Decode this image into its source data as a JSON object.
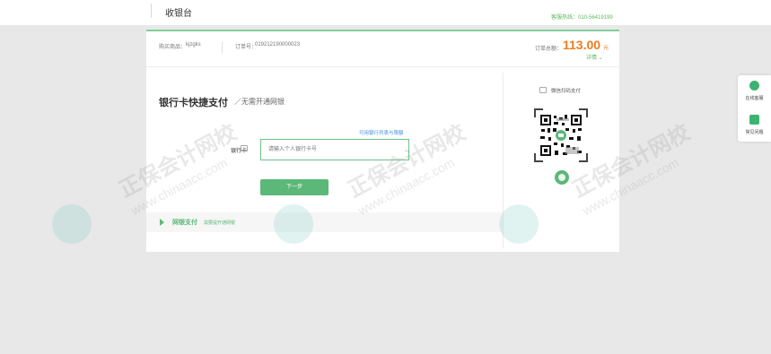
{
  "topbar": {
    "title": "收银台",
    "hotline": "客服热线：010-56419199"
  },
  "order": {
    "merchant_label": "购买商品：",
    "merchant_value": "kjzgks",
    "order_label": "订单号：",
    "order_value": "019212190000023",
    "total_label": "订单总额：",
    "total_amount": "113.00",
    "currency": "元",
    "detail_link": "详情 ⌄"
  },
  "bank_pay": {
    "title": "银行卡快捷支付",
    "subtitle": "／无需开通网银",
    "supported_link": "可用银行列表与限额",
    "card_label": "银行卡",
    "card_placeholder": "请输入个人银行卡号",
    "next_button": "下一步"
  },
  "netbank": {
    "label": "网银支付",
    "note": "需要提开通网银"
  },
  "wechat": {
    "label": "微信扫码支付"
  },
  "side": {
    "online_service": "在线客服",
    "faq": "常见问题"
  },
  "watermark": {
    "text": "正保会计网校",
    "url": "www.chinaacc.com"
  },
  "colors": {
    "accent_green": "#5cb878",
    "amount_orange": "#ef7c1e",
    "link_blue": "#4a90d9"
  }
}
